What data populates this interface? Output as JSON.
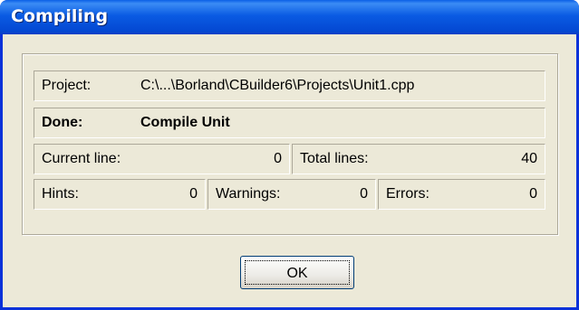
{
  "window": {
    "title": "Compiling"
  },
  "project": {
    "label": "Project:",
    "value": "C:\\...\\Borland\\CBuilder6\\Projects\\Unit1.cpp"
  },
  "status": {
    "label": "Done:",
    "value": "Compile Unit"
  },
  "current_line": {
    "label": "Current line:",
    "value": "0"
  },
  "total_lines": {
    "label": "Total lines:",
    "value": "40"
  },
  "hints": {
    "label": "Hints:",
    "value": "0"
  },
  "warnings": {
    "label": "Warnings:",
    "value": "0"
  },
  "errors": {
    "label": "Errors:",
    "value": "0"
  },
  "ok_button": {
    "label": "OK"
  }
}
